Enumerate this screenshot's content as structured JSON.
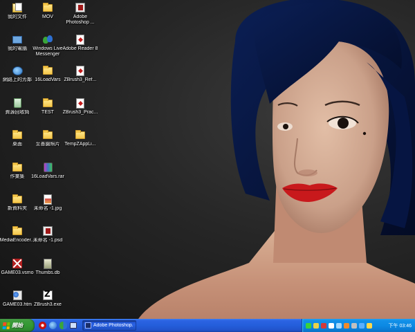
{
  "desktop": {
    "icons": [
      {
        "id": "my-documents",
        "label": "我的文件",
        "icon": "my-documents-icon"
      },
      {
        "id": "mov",
        "label": "MOV",
        "icon": "folder-icon"
      },
      {
        "id": "adobe-photoshop",
        "label": "Adobe Photoshop ...",
        "icon": "photoshop-icon"
      },
      {
        "id": "my-computer",
        "label": "我的電腦",
        "icon": "computer-icon"
      },
      {
        "id": "windows-live-messenger",
        "label": "Windows Live Messenger",
        "icon": "messenger-icon"
      },
      {
        "id": "adobe-reader",
        "label": "Adobe Reader 8",
        "icon": "pdf-icon"
      },
      {
        "id": "network-places",
        "label": "網路上的芳鄰",
        "icon": "network-icon"
      },
      {
        "id": "16loadvars",
        "label": "16LoadVars",
        "icon": "folder-icon"
      },
      {
        "id": "zbrush3-ref",
        "label": "ZBrush3_Ref...",
        "icon": "pdf-icon"
      },
      {
        "id": "recycle-bin",
        "label": "資源回收筒",
        "icon": "recycle-bin-icon"
      },
      {
        "id": "test",
        "label": "TEST",
        "icon": "folder-icon"
      },
      {
        "id": "zbrush3-prac",
        "label": "ZBrush3_Prac...",
        "icon": "pdf-icon"
      },
      {
        "id": "desktop-folder",
        "label": "桌面",
        "icon": "folder-icon"
      },
      {
        "id": "photos",
        "label": "至善園照片",
        "icon": "folder-icon"
      },
      {
        "id": "tempzappli",
        "label": "TempZAppLi...",
        "icon": "folder-icon"
      },
      {
        "id": "homework",
        "label": "作業集",
        "icon": "folder-icon"
      },
      {
        "id": "16loadvars-rar",
        "label": "16LoadVars.rar",
        "icon": "archive-icon"
      },
      {
        "id": "new-folder",
        "label": "新資料夾",
        "icon": "folder-icon"
      },
      {
        "id": "untitled-jpg",
        "label": "未命名 -1.jpg",
        "icon": "image-icon"
      },
      {
        "id": "media-encoder",
        "label": "MediaEncoder...",
        "icon": "folder-icon"
      },
      {
        "id": "untitled-psd",
        "label": "未命名 -1.psd",
        "icon": "psd-icon"
      },
      {
        "id": "game03-vsmo",
        "label": "GAME03.vsmo",
        "icon": "media-file-icon"
      },
      {
        "id": "thumbs-db",
        "label": "Thumbs.db",
        "icon": "thumbs-db-icon"
      },
      {
        "id": "game03-htm",
        "label": "GAME03.htm",
        "icon": "html-file-icon"
      },
      {
        "id": "zbrush3-exe",
        "label": "ZBrush3.exe",
        "icon": "zbrush-icon"
      }
    ]
  },
  "taskbar": {
    "start_label": "開始",
    "quick_launch": [
      "opera-icon",
      "internet-explorer-icon",
      "messenger-icon",
      "show-desktop-icon"
    ],
    "task_button_label": "Adobe Photoshop...",
    "clock": "下午 03:46"
  },
  "colors": {
    "taskbar_blue": "#245edb",
    "start_green": "#339933",
    "tray_blue": "#0c8ae4",
    "lip_red": "#c8191c",
    "hair": "#081a45"
  }
}
